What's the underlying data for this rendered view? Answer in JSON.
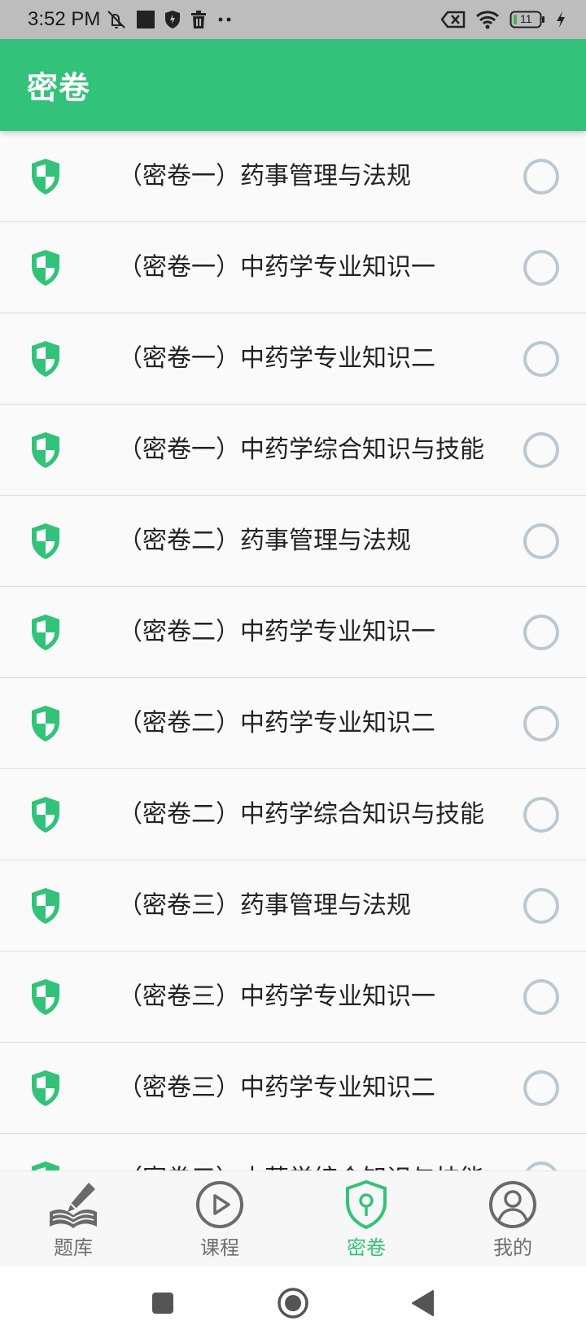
{
  "status_bar": {
    "time": "3:52 PM",
    "battery": "11"
  },
  "app_bar": {
    "title": "密卷"
  },
  "colors": {
    "accent": "#33c27a",
    "radio": "#bcc8cf",
    "nav_inactive": "#6e6e6e"
  },
  "list": {
    "items": [
      {
        "title": "（密卷一）药事管理与法规",
        "selected": false
      },
      {
        "title": "（密卷一）中药学专业知识一",
        "selected": false
      },
      {
        "title": "（密卷一）中药学专业知识二",
        "selected": false
      },
      {
        "title": "（密卷一）中药学综合知识与技能",
        "selected": false
      },
      {
        "title": "（密卷二）药事管理与法规",
        "selected": false
      },
      {
        "title": "（密卷二）中药学专业知识一",
        "selected": false
      },
      {
        "title": "（密卷二）中药学专业知识二",
        "selected": false
      },
      {
        "title": "（密卷二）中药学综合知识与技能",
        "selected": false
      },
      {
        "title": "（密卷三）药事管理与法规",
        "selected": false
      },
      {
        "title": "（密卷三）中药学专业知识一",
        "selected": false
      },
      {
        "title": "（密卷三）中药学专业知识二",
        "selected": false
      },
      {
        "title": "（密卷三）中药学综合知识与技能",
        "selected": false
      }
    ]
  },
  "bottom_nav": {
    "items": [
      {
        "label": "题库",
        "icon": "book-pen-icon",
        "active": false
      },
      {
        "label": "课程",
        "icon": "play-circle-icon",
        "active": false
      },
      {
        "label": "密卷",
        "icon": "shield-key-icon",
        "active": true
      },
      {
        "label": "我的",
        "icon": "user-circle-icon",
        "active": false
      }
    ]
  }
}
